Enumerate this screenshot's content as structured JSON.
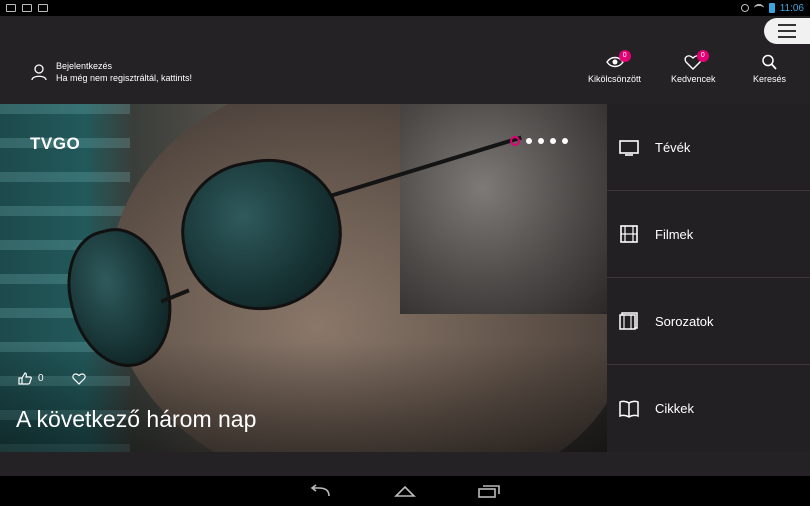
{
  "status_bar": {
    "time": "11:06"
  },
  "header": {
    "menu_icon": "hamburger-icon",
    "login": {
      "icon": "user-icon",
      "title": "Bejelentkezés",
      "subtitle": "Ha még nem regisztráltál, kattints!"
    },
    "nav": [
      {
        "label": "Kikölcsönzött",
        "icon": "eye-icon",
        "badge": "0"
      },
      {
        "label": "Kedvencek",
        "icon": "heart-icon",
        "badge": "0"
      },
      {
        "label": "Keresés",
        "icon": "search-icon"
      }
    ]
  },
  "hero": {
    "logo": "TVGO",
    "title": "A következő három nap",
    "likes": "0",
    "carousel": {
      "count": 5,
      "active": 1
    }
  },
  "side_menu": {
    "items": [
      {
        "label": "Tévék",
        "icon": "tv-icon"
      },
      {
        "label": "Filmek",
        "icon": "film-icon"
      },
      {
        "label": "Sorozatok",
        "icon": "series-icon"
      },
      {
        "label": "Cikkek",
        "icon": "book-icon"
      }
    ]
  },
  "colors": {
    "accent": "#e20074",
    "header_bg": "#252225",
    "panel_bg": "#232023"
  }
}
